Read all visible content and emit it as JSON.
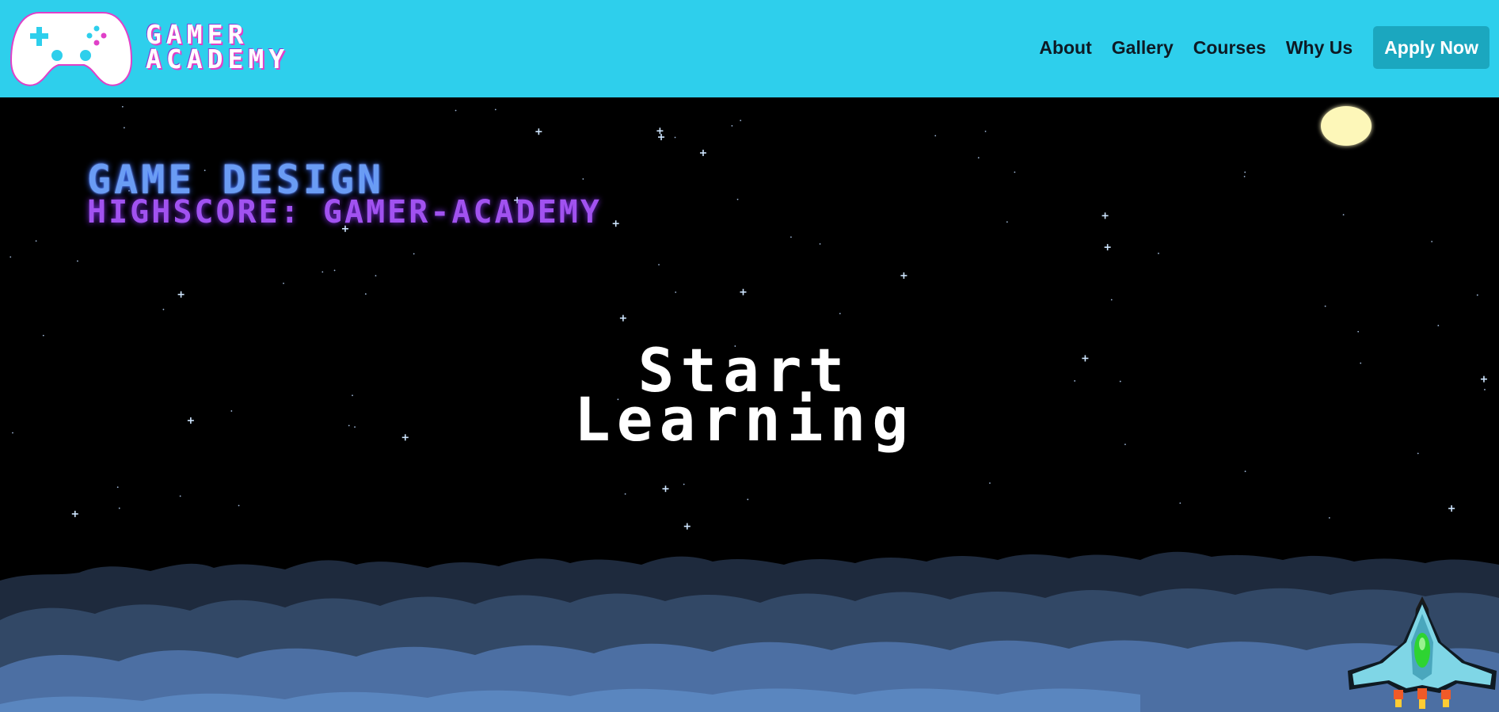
{
  "brand": {
    "line1": "GAMER",
    "line2": "ACADEMY",
    "icon": "gamepad-icon"
  },
  "nav": {
    "items": [
      {
        "label": "About"
      },
      {
        "label": "Gallery"
      },
      {
        "label": "Courses"
      },
      {
        "label": "Why Us"
      }
    ],
    "cta_label": "Apply Now"
  },
  "hero": {
    "title": "GAME DESIGN",
    "subtitle": "HIGHSCORE: GAMER-ACADEMY",
    "cta_line1": "Start",
    "cta_line2": "Learning"
  },
  "colors": {
    "navbar": "#2ecfec",
    "cta_button": "#1ba7bf",
    "title_blue": "#6a9cf4",
    "subtitle_purple": "#a152f0",
    "moon": "#fdf7b9",
    "sky": "#000000"
  },
  "decor": {
    "moon": "moon-icon",
    "ship": "spaceship-icon",
    "clouds": "clouds-illustration"
  }
}
